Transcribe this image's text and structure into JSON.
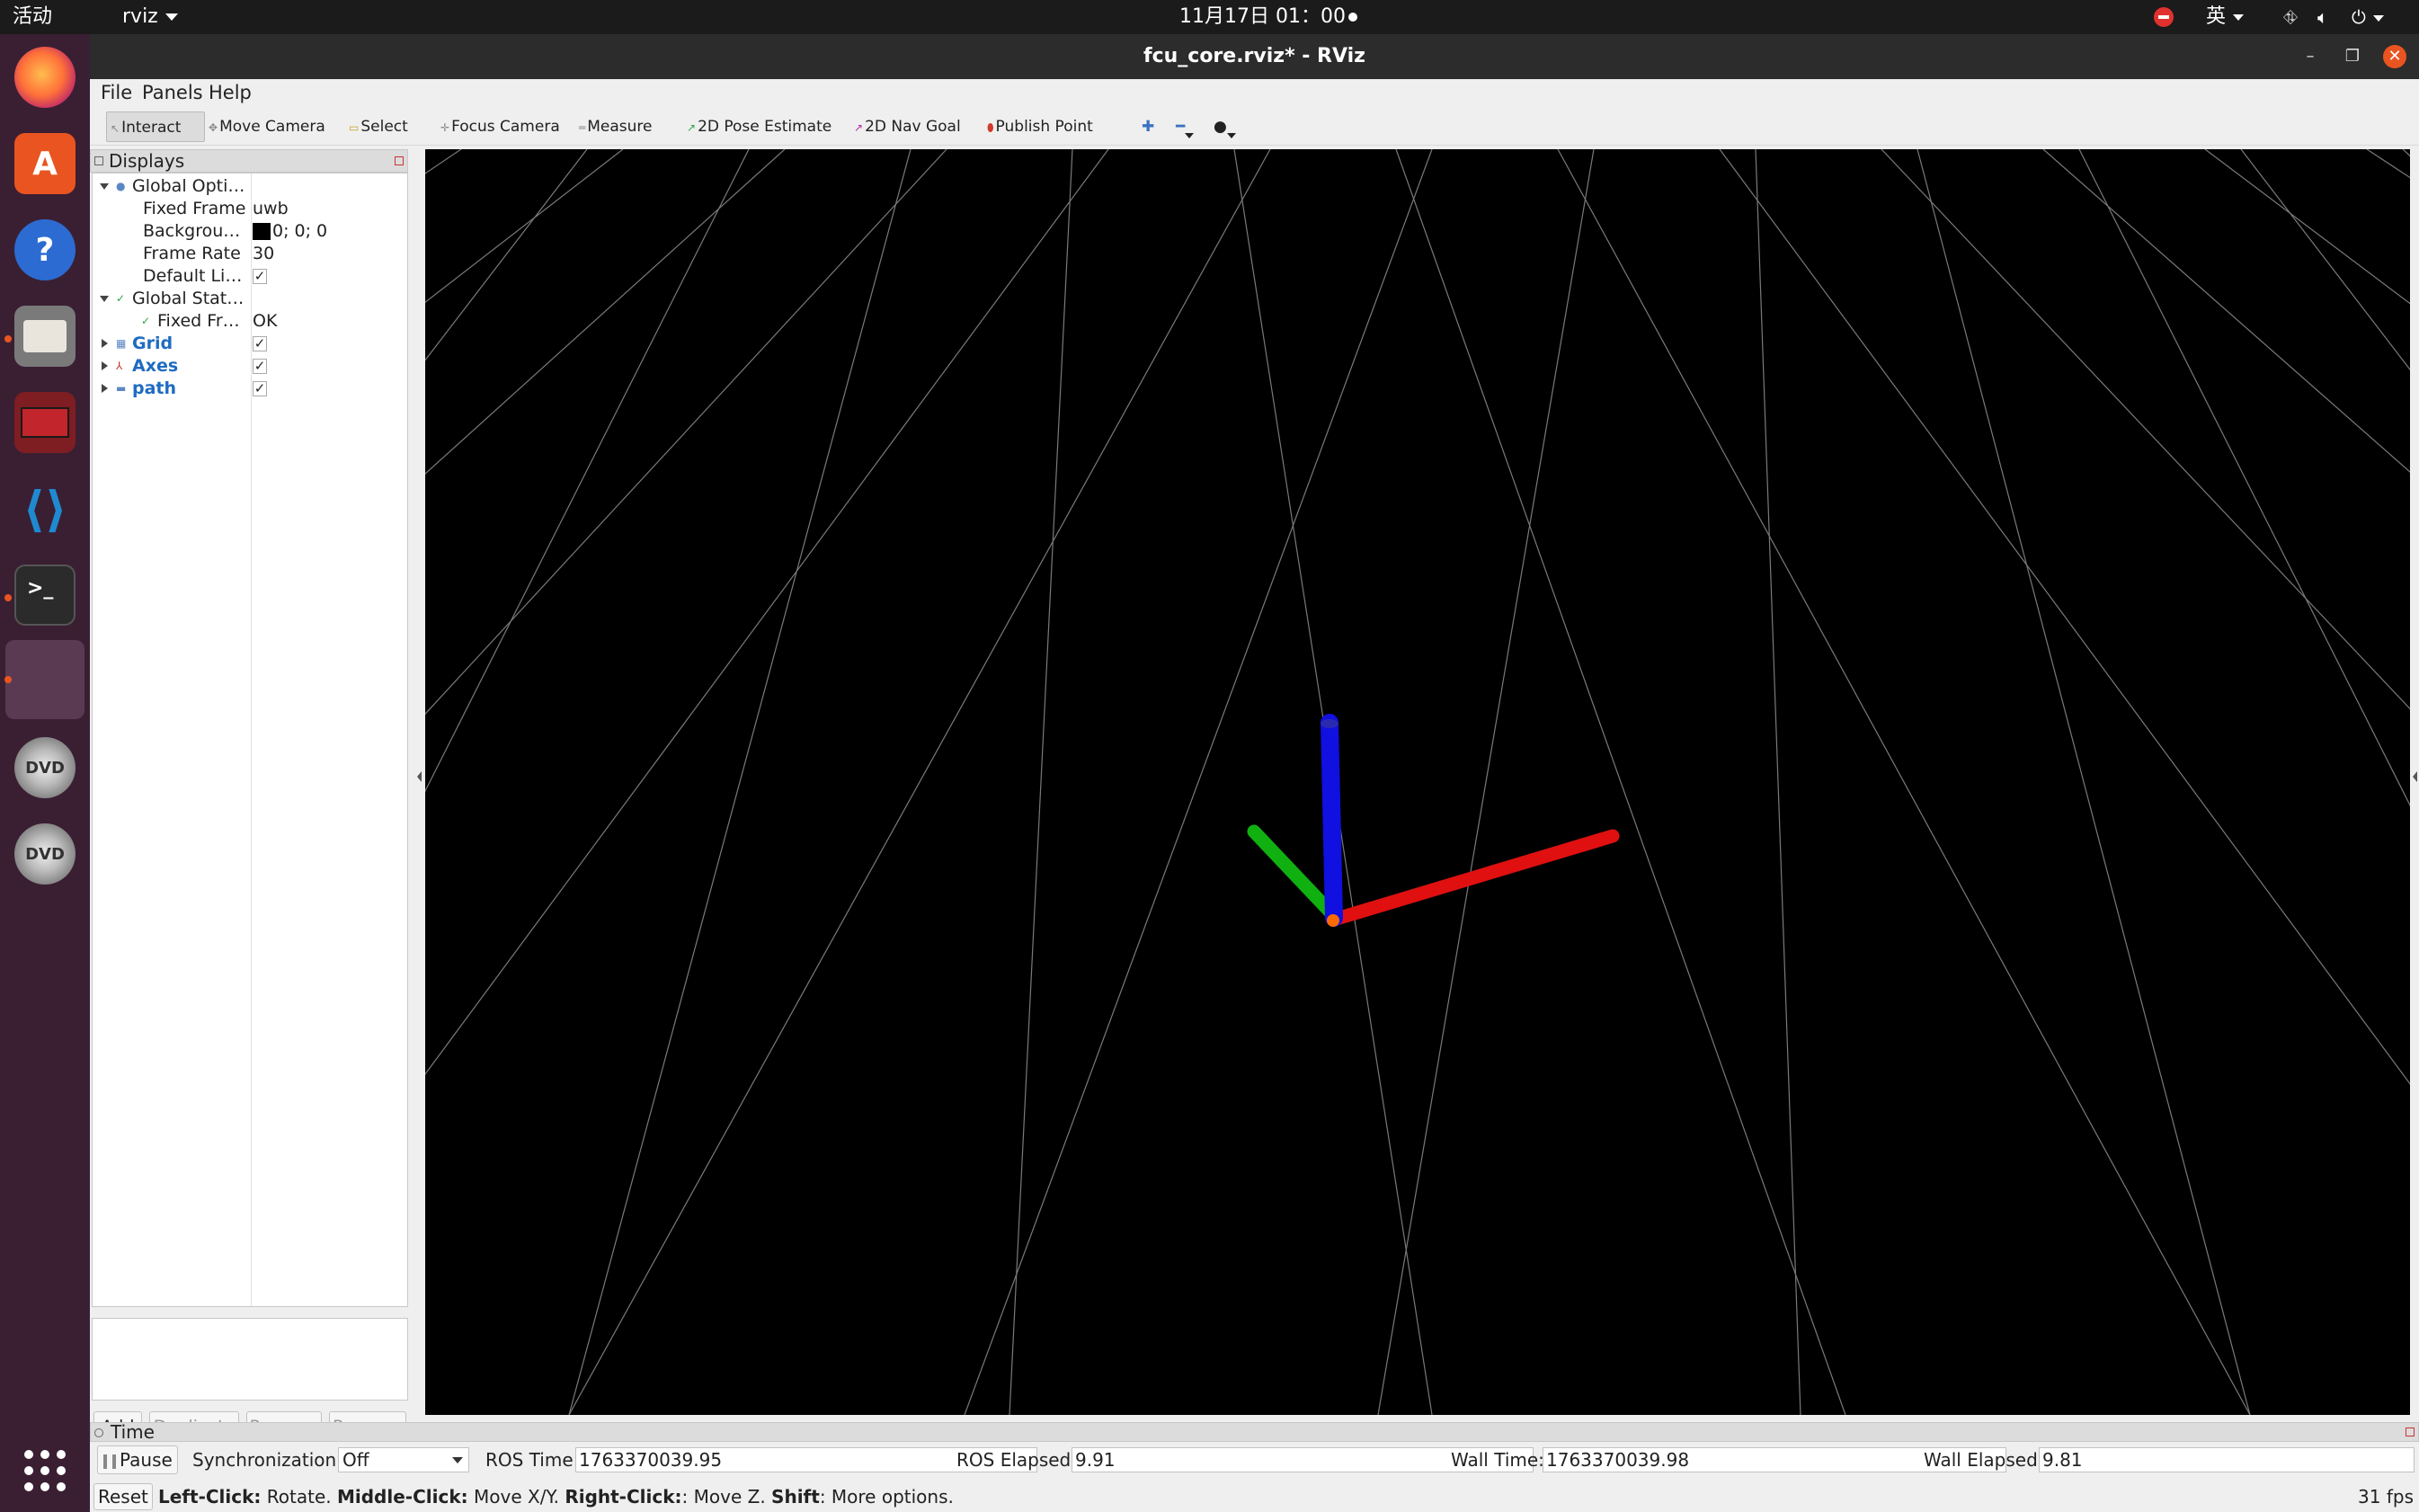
{
  "topbar": {
    "activities": "活动",
    "app_menu": "rviz",
    "clock": "11月17日  01：00",
    "input_method": "英"
  },
  "dock": {
    "items": [
      "firefox-icon",
      "software-icon",
      "help-icon",
      "files-icon",
      "terminal-red-icon",
      "vscode-icon",
      "terminal-icon",
      "active-window-icon",
      "dvd-icon",
      "dvd-icon",
      "show-apps-icon"
    ],
    "terminal_glyph": ">_",
    "dvd_label": "DVD"
  },
  "window": {
    "title": "fcu_core.rviz* - RViz",
    "minimize_glyph": "–",
    "maximize_glyph": "❐",
    "close_glyph": "✕"
  },
  "menu": {
    "file": "File",
    "panels": "Panels",
    "help": "Help"
  },
  "toolbar": {
    "interact": "Interact",
    "move_camera": "Move Camera",
    "select": "Select",
    "focus_camera": "Focus Camera",
    "measure": "Measure",
    "pose_estimate": "2D Pose Estimate",
    "nav_goal": "2D Nav Goal",
    "publish_point": "Publish Point",
    "add_tool_glyph": "✚",
    "remove_tool_glyph": "━",
    "camera_glyph": "●"
  },
  "displays": {
    "title": "Displays",
    "global_options": "Global Opti…",
    "fixed_frame_label": "Fixed Frame",
    "fixed_frame_value": "uwb",
    "background_label": "Backgrou…",
    "background_value": "0; 0; 0",
    "frame_rate_label": "Frame Rate",
    "frame_rate_value": "30",
    "default_light_label": "Default Li…",
    "global_status": "Global Stat…",
    "fixed_frame_status_label": "Fixed Fr…",
    "fixed_frame_status_value": "OK",
    "grid": "Grid",
    "axes": "Axes",
    "path": "path",
    "check_glyph": "✓",
    "buttons": {
      "add": "Add",
      "duplicate": "Duplicate",
      "remove": "Remove",
      "rename": "Rename"
    }
  },
  "time": {
    "title": "Time",
    "pause": "Pause",
    "sync_label": "Synchronization:",
    "sync_value": "Off",
    "ros_time_label": "ROS Time:",
    "ros_time_value": "1763370039.95",
    "ros_elapsed_label": "ROS Elapsed:",
    "ros_elapsed_value": "9.91",
    "wall_time_label": "Wall Time:",
    "wall_time_value": "1763370039.98",
    "wall_elapsed_label": "Wall Elapsed:",
    "wall_elapsed_value": "9.81"
  },
  "status": {
    "reset": "Reset",
    "left_click": "Left-Click:",
    "left_click_desc": " Rotate. ",
    "middle_click": "Middle-Click:",
    "middle_click_desc": " Move X/Y. ",
    "right_click": "Right-Click:",
    "right_click_desc": ": Move Z. ",
    "shift": "Shift",
    "shift_desc": ": More options.",
    "fps": "31 fps"
  },
  "colors": {
    "viewport_background": "#000000",
    "grid_lines": "#7a7a7a",
    "axis_x": "#e01010",
    "axis_y": "#10b010",
    "axis_z": "#1010e0",
    "accent": "#e95420"
  }
}
